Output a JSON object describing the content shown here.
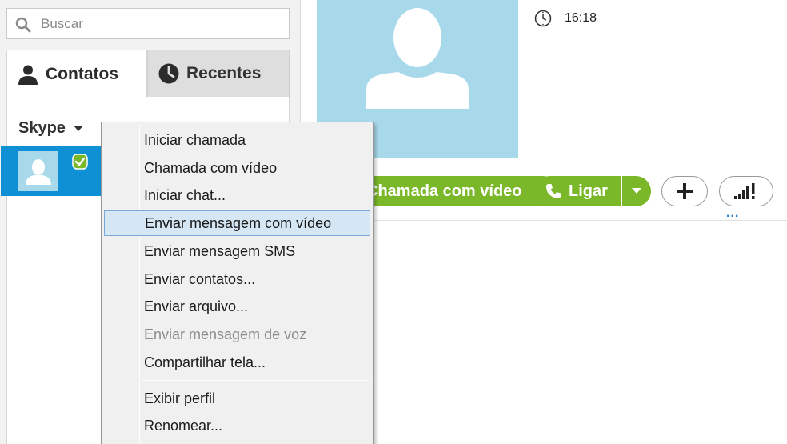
{
  "search": {
    "placeholder": "Buscar"
  },
  "tabs": [
    {
      "label": "Contatos"
    },
    {
      "label": "Recentes"
    }
  ],
  "contacts": {
    "group_label": "Skype"
  },
  "profile": {
    "time": "16:18"
  },
  "actions": {
    "video_call_label": "Chamada com vídeo",
    "call_label": "Ligar",
    "more_label": "..."
  },
  "context_menu": {
    "items": [
      {
        "label": "Iniciar chamada",
        "state": "normal"
      },
      {
        "label": "Chamada com vídeo",
        "state": "normal"
      },
      {
        "label": "Iniciar chat...",
        "state": "normal"
      },
      {
        "label": "Enviar mensagem com vídeo",
        "state": "highlighted"
      },
      {
        "label": "Enviar mensagem SMS",
        "state": "normal"
      },
      {
        "label": "Enviar contatos...",
        "state": "normal"
      },
      {
        "label": "Enviar arquivo...",
        "state": "normal"
      },
      {
        "label": "Enviar mensagem de voz",
        "state": "disabled"
      },
      {
        "label": "Compartilhar tela...",
        "state": "normal"
      },
      {
        "label": "Exibir perfil",
        "state": "normal"
      },
      {
        "label": "Renomear...",
        "state": "normal"
      }
    ]
  },
  "colors": {
    "accent_green": "#7ab82a",
    "selection_blue": "#0f8fd4",
    "avatar_bg": "#a8d9ea",
    "menu_highlight": "#d5e6f5"
  },
  "icons": [
    "search-icon",
    "person-icon",
    "clock-icon",
    "caret-down-icon",
    "check-badge-icon",
    "phone-icon",
    "plus-icon",
    "signal-icon"
  ]
}
